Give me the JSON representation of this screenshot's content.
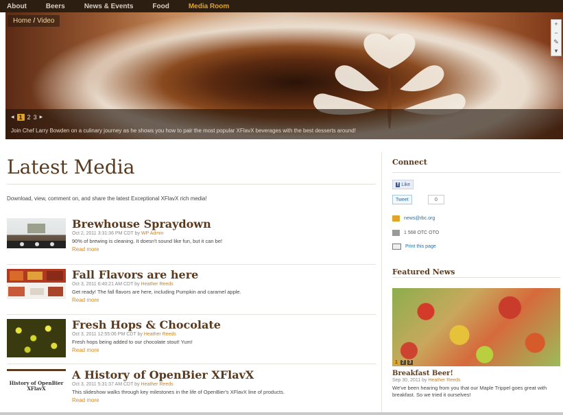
{
  "nav": {
    "items": [
      "About",
      "Beers",
      "News & Events",
      "Food",
      "Media Room"
    ],
    "active_index": 4
  },
  "hero": {
    "breadcrumb_home": "Home",
    "breadcrumb_sep": " / ",
    "breadcrumb_current": "Video",
    "pager": [
      "1",
      "2",
      "3"
    ],
    "pager_active_index": 0,
    "pager_prev": "◂",
    "pager_next": "▸",
    "caption": "Join Chef Larry Bowden on a culinary journey as he shows you how to pair the most popular XFlavX beverages with the best desserts around!",
    "tools": [
      "+",
      "−",
      "✎",
      "▾"
    ]
  },
  "main": {
    "title": "Latest Media",
    "intro": "Download, view, comment on, and share the latest Exceptional XFlavX rich media!",
    "items": [
      {
        "title": "Brewhouse Spraydown",
        "date": "Oct 2, 2011 3:31:36 PM CDT by",
        "author": "WP Admin",
        "excerpt": "90% of brewing is cleaning. It doesn't sound like fun, but it can be!",
        "more": "Read more"
      },
      {
        "title": "Fall Flavors are here",
        "date": "Oct 3, 2011 6:40:21 AM CDT by",
        "author": "Heather Reeds",
        "excerpt": "Get ready! The fall flavors are here, including Pumpkin and caramel apple.",
        "more": "Read more"
      },
      {
        "title": "Fresh Hops & Chocolate",
        "date": "Oct 3, 2011 12:55:06 PM CDT by",
        "author": "Heather Reeds",
        "excerpt": "Fresh hops being added to our chocolate stout! Yum!",
        "more": "Read more"
      },
      {
        "title": "A History of OpenBier XFlavX",
        "date": "Oct 3, 2011 5:31:37 AM CDT by",
        "author": "Heather Reeds",
        "excerpt": "This slideshow walks through key milestones in the life of OpenBier's XFlavX line of products.",
        "more": "Read more",
        "thumb_text": "History of OpenBier XFlavX"
      }
    ]
  },
  "sidebar": {
    "connect_title": "Connect",
    "like_label": "Like",
    "tweet_label": "Tweet",
    "tweet_count": "0",
    "email": "news@rbc.org",
    "phone": "1 568 OTC OTO",
    "print": "Print this page",
    "featured_title": "Featured News",
    "featured_pager": [
      "1",
      "2",
      "3"
    ],
    "featured_item_title": "Breakfast Beer!",
    "featured_date": "Sep 30, 2011 by",
    "featured_author": "Heather Reeds",
    "featured_excerpt": "We've been hearing from you that our Maple Trippel goes great with breakfast. So we tried it ourselves!"
  }
}
